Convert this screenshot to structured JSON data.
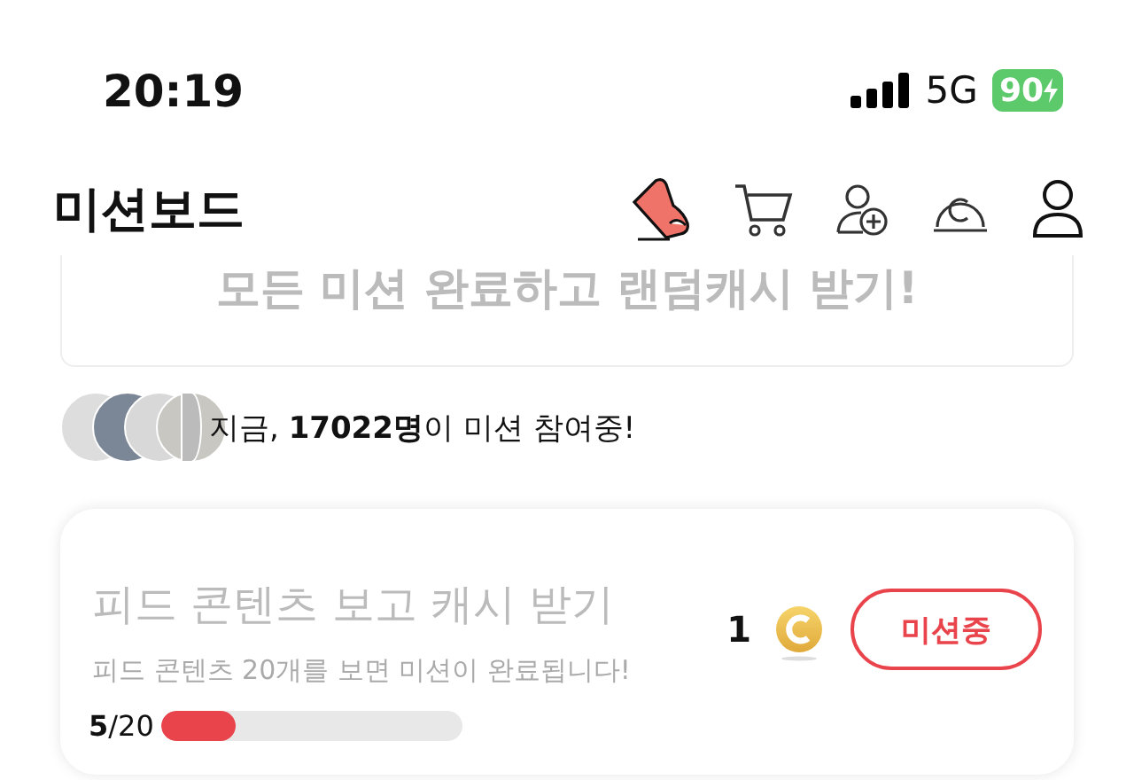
{
  "status_bar": {
    "time": "20:19",
    "network": "5G",
    "battery": "90"
  },
  "header": {
    "title": "미션보드"
  },
  "banner": {
    "text": "모든 미션 완료하고 랜덤캐시 받기!"
  },
  "participants": {
    "text": "지금, **17022명**이 미션 참여중!"
  },
  "missions": [
    {
      "title": "피드 콘텐츠 보고 캐시 받기",
      "description": "피드 콘텐츠 20개를 보면 미션이 완료됩니다!",
      "progress": "**5**/20",
      "level": 0.25,
      "reward": "1",
      "button": "미션중"
    }
  ]
}
